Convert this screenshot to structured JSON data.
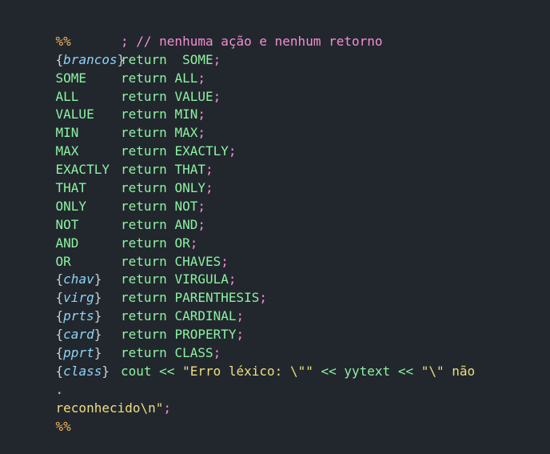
{
  "colors": {
    "background": "#22272e",
    "percent": "#f0b35a",
    "token": "#8cf2a0",
    "definition": "#8fd4f5",
    "punctuation": "#f48ed2",
    "string": "#f0de7f"
  },
  "code": {
    "open_delim": "%%",
    "close_delim": "%%",
    "brancos_line": {
      "open_brace": "{",
      "name": "brancos",
      "close_brace": "}",
      "comment": "; // nenhuma ação e nenhum retorno"
    },
    "rules": [
      {
        "pattern": "SOME",
        "keyword": "return",
        "token": " SOME",
        "semi": ";"
      },
      {
        "pattern": "ALL",
        "keyword": "return",
        "token": "ALL",
        "semi": ";"
      },
      {
        "pattern": "VALUE",
        "keyword": "return",
        "token": "VALUE",
        "semi": ";"
      },
      {
        "pattern": "MIN",
        "keyword": "return",
        "token": "MIN",
        "semi": ";"
      },
      {
        "pattern": "MAX",
        "keyword": "return",
        "token": "MAX",
        "semi": ";"
      },
      {
        "pattern": "EXACTLY",
        "keyword": "return",
        "token": "EXACTLY",
        "semi": ";"
      },
      {
        "pattern": "THAT",
        "keyword": "return",
        "token": "THAT",
        "semi": ";"
      },
      {
        "pattern": "ONLY",
        "keyword": "return",
        "token": "ONLY",
        "semi": ";"
      },
      {
        "pattern": "NOT",
        "keyword": "return",
        "token": "NOT",
        "semi": ";"
      },
      {
        "pattern": "AND",
        "keyword": "return",
        "token": "AND",
        "semi": ";"
      },
      {
        "pattern": "OR",
        "keyword": "return",
        "token": "OR",
        "semi": ";"
      }
    ],
    "def_rules": [
      {
        "open": "{",
        "name": "chav",
        "close": "}",
        "keyword": "return",
        "token": "CHAVES",
        "semi": ";"
      },
      {
        "open": "{",
        "name": "virg",
        "close": "}",
        "keyword": "return",
        "token": "VIRGULA",
        "semi": ";"
      },
      {
        "open": "{",
        "name": "prts",
        "close": "}",
        "keyword": "return",
        "token": "PARENTHESIS",
        "semi": ";"
      },
      {
        "open": "{",
        "name": "card",
        "close": "}",
        "keyword": "return",
        "token": "CARDINAL",
        "semi": ";"
      },
      {
        "open": "{",
        "name": "pprt",
        "close": "}",
        "keyword": "return",
        "token": "PROPERTY",
        "semi": ";"
      },
      {
        "open": "{",
        "name": "class",
        "close": "}",
        "keyword": "return",
        "token": "CLASS",
        "semi": ";"
      }
    ],
    "error_rule": {
      "pattern": ".",
      "cout": "cout <<",
      "str1": "\"Erro léxico: \\\"\"",
      "op2": "<< yytext <<",
      "str2a": "\"\\\" não",
      "str2b": "reconhecido\\n\"",
      "semi": ";"
    }
  }
}
